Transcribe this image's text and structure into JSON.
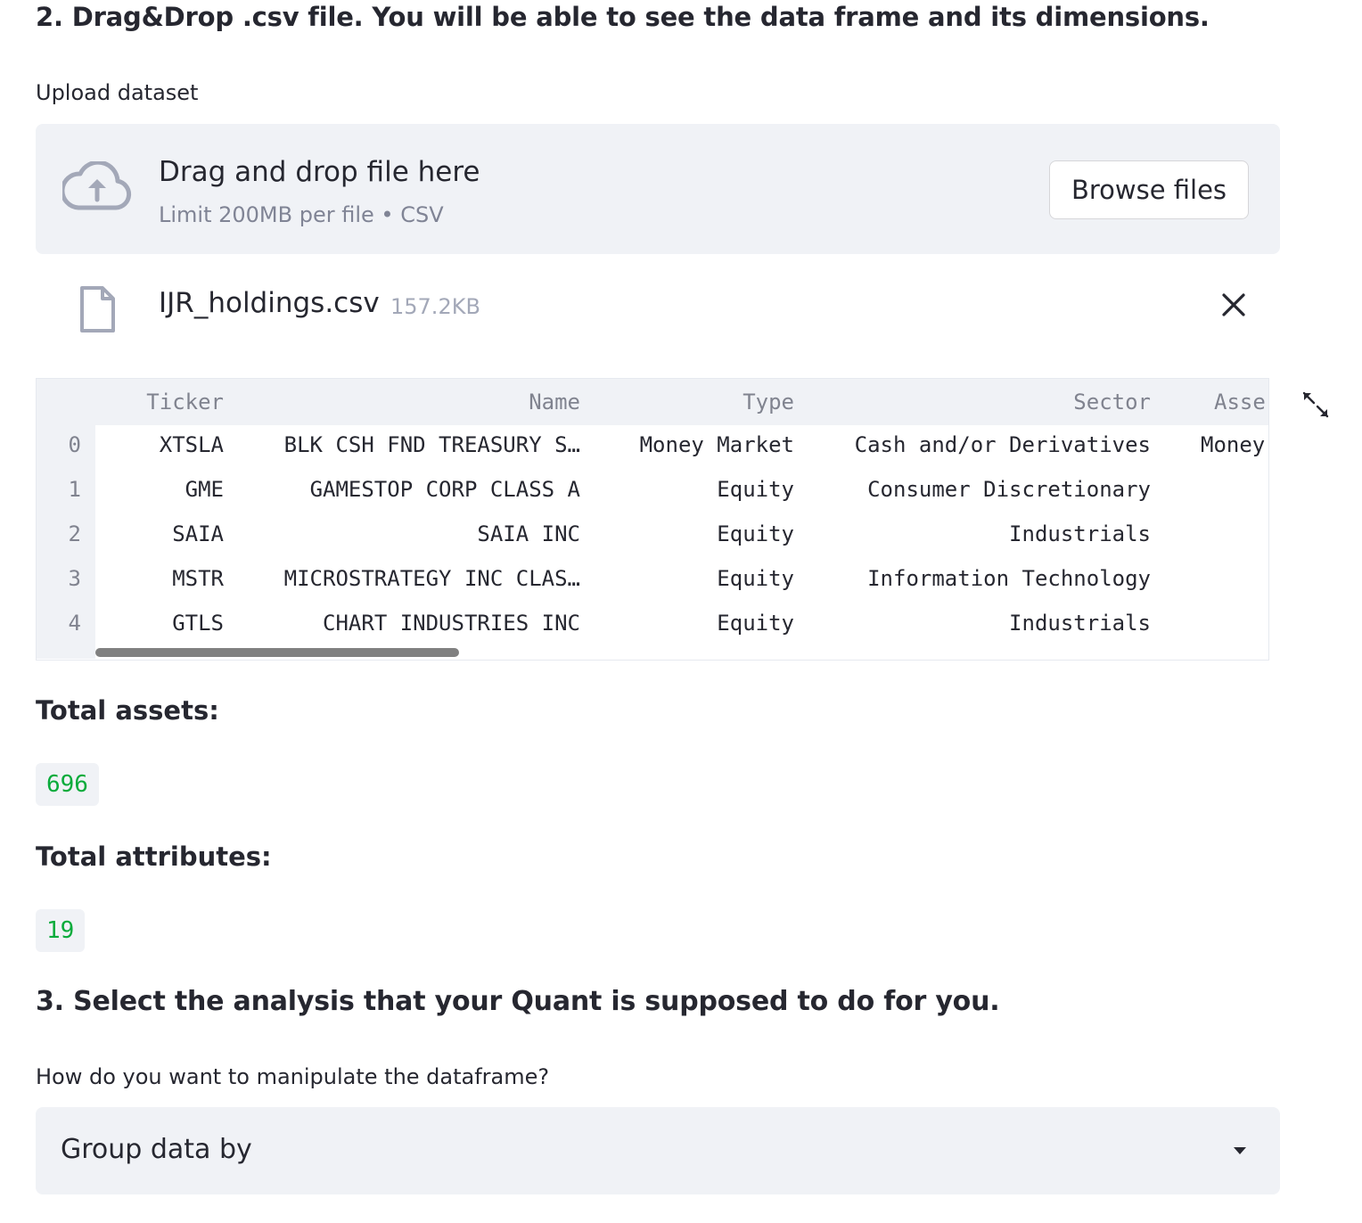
{
  "step2": {
    "heading": "2. Drag&Drop .csv file. You will be able to see the data frame and its dimensions."
  },
  "uploader": {
    "label": "Upload dataset",
    "dropzone_title": "Drag and drop file here",
    "dropzone_subtitle": "Limit 200MB per file • CSV",
    "browse_label": "Browse files",
    "icon": "cloud-upload-icon"
  },
  "uploaded_file": {
    "name": "IJR_holdings.csv",
    "size": "157.2KB",
    "icon": "file-icon",
    "remove_icon": "close-icon"
  },
  "dataframe": {
    "columns": [
      "Ticker",
      "Name",
      "Type",
      "Sector",
      "Asse"
    ],
    "rows": [
      {
        "index": "0",
        "cells": [
          "XTSLA",
          "BLK CSH FND TREASURY S…",
          "Money Market",
          "Cash and/or Derivatives",
          "Money"
        ]
      },
      {
        "index": "1",
        "cells": [
          "GME",
          "GAMESTOP CORP CLASS A",
          "Equity",
          "Consumer Discretionary",
          ""
        ]
      },
      {
        "index": "2",
        "cells": [
          "SAIA",
          "SAIA INC",
          "Equity",
          "Industrials",
          ""
        ]
      },
      {
        "index": "3",
        "cells": [
          "MSTR",
          "MICROSTRATEGY INC CLAS…",
          "Equity",
          "Information Technology",
          ""
        ]
      },
      {
        "index": "4",
        "cells": [
          "GTLS",
          "CHART INDUSTRIES INC",
          "Equity",
          "Industrials",
          ""
        ]
      }
    ],
    "expand_icon": "expand-icon"
  },
  "metrics": {
    "assets_label": "Total assets:",
    "assets_value": "696",
    "attributes_label": "Total attributes:",
    "attributes_value": "19"
  },
  "step3": {
    "heading": "3. Select the analysis that your Quant is supposed to do for you.",
    "select_label": "How do you want to manipulate the dataframe?",
    "select_value": "Group data by",
    "caret_icon": "chevron-down-icon"
  },
  "colors": {
    "accent_green": "#09ab3b",
    "panel_bg": "#f0f2f6",
    "text": "#262730",
    "muted": "#808495"
  }
}
